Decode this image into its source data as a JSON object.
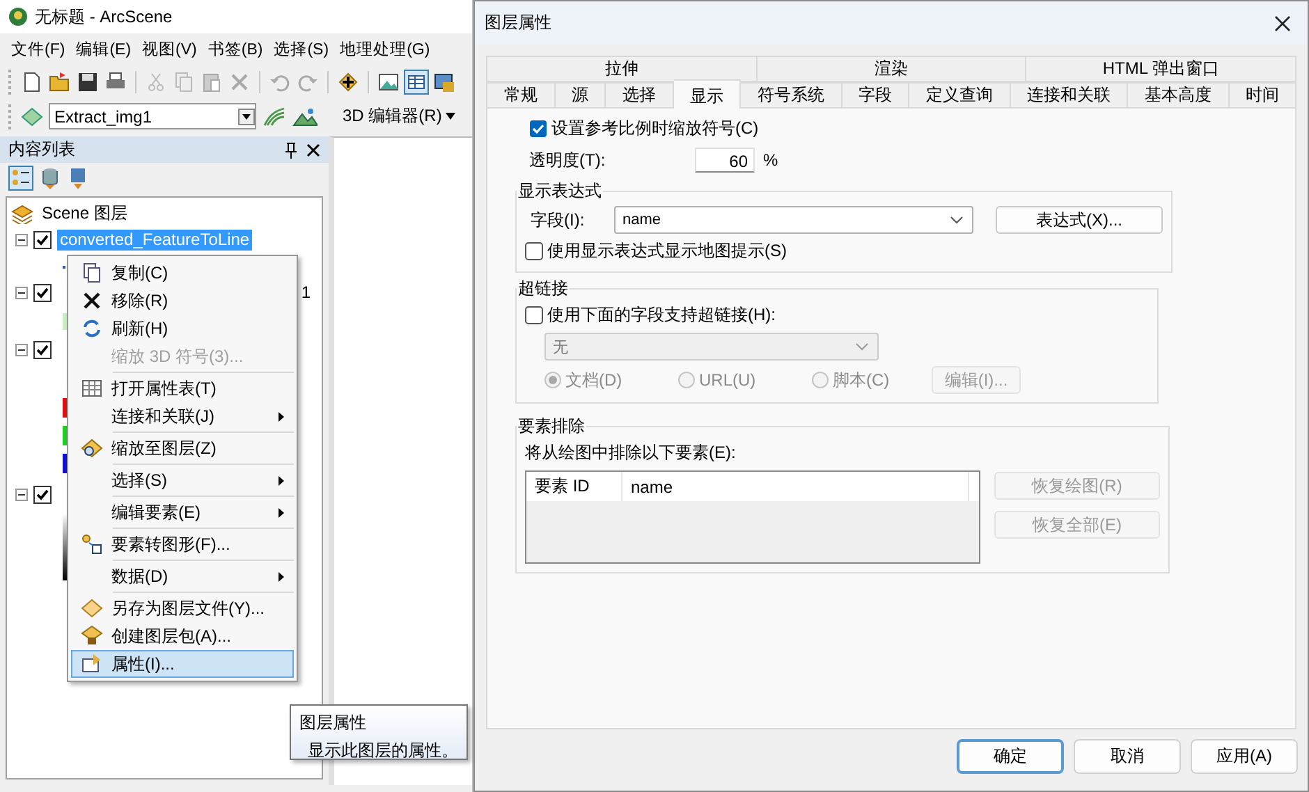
{
  "app": {
    "title": "无标题 - ArcScene",
    "menu": [
      "文件(F)",
      "编辑(E)",
      "视图(V)",
      "书签(B)",
      "选择(S)",
      "地理处理(G)"
    ],
    "layer_combo": "Extract_img1",
    "editor_menu": "3D 编辑器(R)",
    "toc": {
      "title": "内容列表",
      "root": "Scene 图层",
      "layers": [
        {
          "label": "converted_FeatureToLine",
          "kind": "line",
          "checked": true,
          "expanded": true,
          "selected": true
        },
        {
          "label": "1",
          "kind": "polygon",
          "checked": true,
          "expanded": true,
          "selected": false
        },
        {
          "kind": "rgb",
          "checked": true,
          "expanded": true
        },
        {
          "kind": "stretch",
          "checked": true,
          "expanded": true
        }
      ]
    }
  },
  "context_menu": {
    "sections": [
      [
        {
          "label": "复制(C)",
          "disabled": false,
          "submenu": false,
          "selected": false
        },
        {
          "label": "移除(R)",
          "disabled": false,
          "submenu": false,
          "selected": false
        },
        {
          "label": "刷新(H)",
          "disabled": false,
          "submenu": false,
          "selected": false
        },
        {
          "label": "缩放 3D 符号(3)...",
          "disabled": true,
          "submenu": false,
          "selected": false
        }
      ],
      [
        {
          "label": "打开属性表(T)",
          "disabled": false,
          "submenu": false,
          "selected": false
        },
        {
          "label": "连接和关联(J)",
          "disabled": false,
          "submenu": true,
          "selected": false
        }
      ],
      [
        {
          "label": "缩放至图层(Z)",
          "disabled": false,
          "submenu": false,
          "selected": false
        }
      ],
      [
        {
          "label": "选择(S)",
          "disabled": false,
          "submenu": true,
          "selected": false
        }
      ],
      [
        {
          "label": "编辑要素(E)",
          "disabled": false,
          "submenu": true,
          "selected": false
        }
      ],
      [
        {
          "label": "要素转图形(F)...",
          "disabled": false,
          "submenu": false,
          "selected": false
        }
      ],
      [
        {
          "label": "数据(D)",
          "disabled": false,
          "submenu": true,
          "selected": false
        }
      ],
      [
        {
          "label": "另存为图层文件(Y)...",
          "disabled": false,
          "submenu": false,
          "selected": false
        },
        {
          "label": "创建图层包(A)...",
          "disabled": false,
          "submenu": false,
          "selected": false
        },
        {
          "label": "属性(I)...",
          "disabled": false,
          "submenu": false,
          "selected": true
        }
      ]
    ]
  },
  "tooltip": {
    "title": "图层属性",
    "text": "显示此图层的属性。"
  },
  "dialog": {
    "title": "图层属性",
    "tab_rows": [
      [
        {
          "label": "拉伸",
          "selected": false
        },
        {
          "label": "渲染",
          "selected": false
        },
        {
          "label": "HTML 弹出窗口",
          "selected": false
        }
      ],
      [
        {
          "label": "常规",
          "selected": false
        },
        {
          "label": "源",
          "selected": false
        },
        {
          "label": "选择",
          "selected": false
        },
        {
          "label": "显示",
          "selected": true
        },
        {
          "label": "符号系统",
          "selected": false
        },
        {
          "label": "字段",
          "selected": false
        },
        {
          "label": "定义查询",
          "selected": false
        },
        {
          "label": "连接和关联",
          "selected": false
        },
        {
          "label": "基本高度",
          "selected": false
        },
        {
          "label": "时间",
          "selected": false
        }
      ]
    ],
    "scale_symbols": {
      "label": "设置参考比例时缩放符号(C)",
      "checked": true
    },
    "transparency": {
      "label": "透明度(T):",
      "value": "60",
      "unit": "%"
    },
    "display_expression": {
      "title": "显示表达式",
      "field_label": "字段(I):",
      "field_value": "name",
      "expression_button": "表达式(X)...",
      "maptips": {
        "label": "使用显示表达式显示地图提示(S)",
        "checked": false
      }
    },
    "hyperlinks": {
      "title": "超链接",
      "support": {
        "label": "使用下面的字段支持超链接(H):",
        "checked": false
      },
      "disabled": true,
      "field_value": "无",
      "types": [
        {
          "label": "文档(D)",
          "selected": true
        },
        {
          "label": "URL(U)",
          "selected": false
        },
        {
          "label": "脚本(C)",
          "selected": false
        }
      ],
      "edit_button": "编辑(I)..."
    },
    "exclusion": {
      "title": "要素排除",
      "label": "将从绘图中排除以下要素(E):",
      "columns": [
        "要素 ID",
        "name"
      ],
      "buttons": [
        "恢复绘图(R)",
        "恢复全部(E)"
      ],
      "buttons_disabled": true
    },
    "buttons": [
      {
        "label": "确定",
        "default": true
      },
      {
        "label": "取消",
        "default": false
      },
      {
        "label": "应用(A)",
        "default": false
      }
    ]
  }
}
